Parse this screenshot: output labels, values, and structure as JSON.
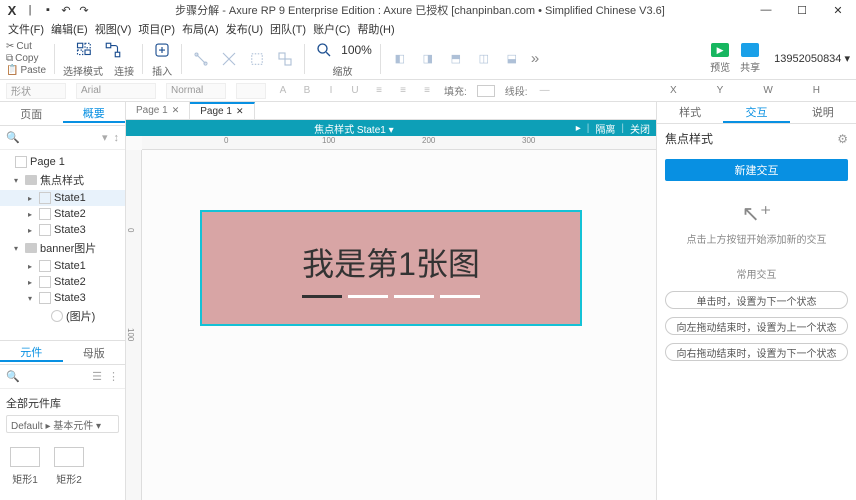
{
  "titlebar": {
    "title": "步骤分解 - Axure RP 9 Enterprise Edition : Axure 已授权     [chanpinban.com • Simplified Chinese V3.6]"
  },
  "menu": [
    "文件(F)",
    "编辑(E)",
    "视图(V)",
    "项目(P)",
    "布局(A)",
    "发布(U)",
    "团队(T)",
    "账户(C)",
    "帮助(H)"
  ],
  "clip": {
    "cut": "Cut",
    "copy": "Copy",
    "paste": "Paste"
  },
  "toolGroups": {
    "select": "选择模式",
    "connect": "连接",
    "insert": "插入",
    "point": "交点",
    "slice": "切片",
    "combine": "组合",
    "ungroup": "取消组合",
    "zoom": "缩放",
    "left": "左侧",
    "right": "右侧",
    "top": "顶部",
    "middle": "中部",
    "bottom": "底部"
  },
  "zoom": "100%",
  "preview": {
    "run": "预览",
    "share": "共享"
  },
  "phone": "13952050834 ▾",
  "fmt": {
    "style": "形状",
    "font": "Arial",
    "weight": "Normal",
    "size": "  ",
    "fill": "填充:",
    "line": "线段:"
  },
  "leftTabs": {
    "page": "页面",
    "outline": "概要"
  },
  "tree": {
    "page": "Page 1",
    "focus": "焦点样式",
    "state1": "State1",
    "state2": "State2",
    "state3": "State3",
    "banner": "banner图片",
    "bstate1": "State1",
    "bstate2": "State2",
    "bstate3": "State3",
    "pic": "(图片)"
  },
  "libTabs": {
    "widgets": "元件",
    "masters": "母版"
  },
  "lib": {
    "title": "全部元件库",
    "dropdown": "Default ▸ 基本元件 ▾",
    "rect1": "矩形1",
    "rect2": "矩形2"
  },
  "pageTabs": {
    "p1": "Page 1",
    "p2": "Page 1"
  },
  "dpBar": {
    "title": "焦点样式  State1 ▾",
    "isolate": "隔离",
    "close": "关闭"
  },
  "widget": {
    "text": "我是第1张图"
  },
  "rp": {
    "tabs": {
      "style": "样式",
      "interact": "交互",
      "notes": "说明"
    },
    "title": "焦点样式",
    "newBtn": "新建交互",
    "hint": "点击上方按钮开始添加新的交互",
    "commonTitle": "常用交互",
    "opt1": "单击时，设置为下一个状态",
    "opt2": "向左拖动结束时，设置为上一个状态",
    "opt3": "向右拖动结束时，设置为下一个状态"
  },
  "sizebar": {
    "x": "X",
    "y": "Y",
    "w": "W",
    "h": "H"
  }
}
